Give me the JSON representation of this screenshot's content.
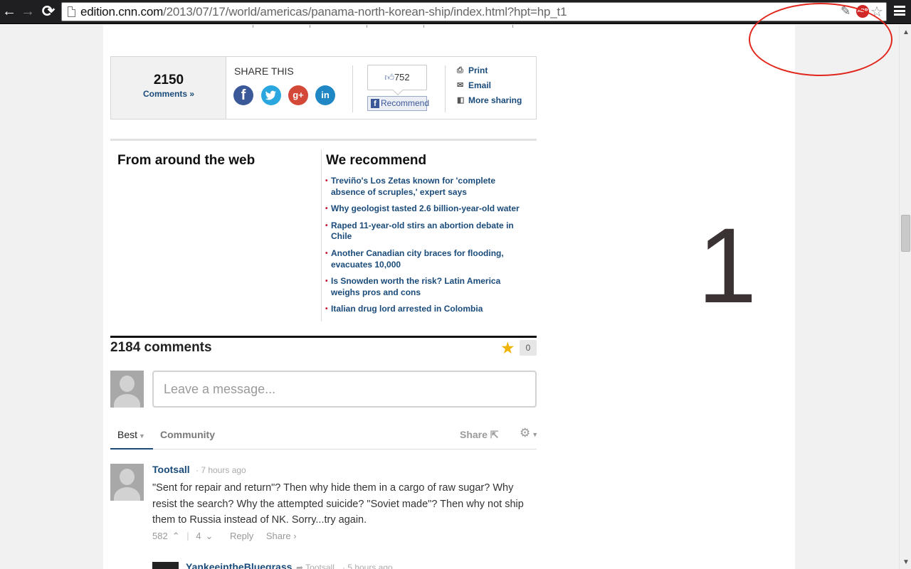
{
  "browser": {
    "url_domain": "edition.cnn.com",
    "url_path": "/2013/07/17/world/americas/panama-north-korean-ship/index.html?hpt=hp_t1",
    "back_glyph": "←",
    "forward_glyph": "→",
    "reload_glyph": "⟳",
    "abp_label": "ABP",
    "extension_icons": [
      "pen-icon",
      "adblock-icon",
      "star-icon"
    ]
  },
  "annotation": {
    "number": "1",
    "ellipse_color": "#e1261c"
  },
  "share_bar": {
    "comment_count": "2150",
    "comments_link": "Comments »",
    "title": "SHARE THIS",
    "social": [
      {
        "name": "facebook-icon",
        "glyph": "f"
      },
      {
        "name": "twitter-icon",
        "glyph": "t"
      },
      {
        "name": "googleplus-icon",
        "glyph": "g+"
      },
      {
        "name": "linkedin-icon",
        "glyph": "in"
      }
    ],
    "like_count": "752",
    "recommend_label": "Recommend",
    "links": {
      "print": "Print",
      "email": "Email",
      "more": "More sharing"
    }
  },
  "recommendations": {
    "left_title": "From around the web",
    "right_title": "We recommend",
    "items": [
      "Treviño's Los Zetas known for 'complete absence of scruples,' expert says",
      "Why geologist tasted 2.6 billion-year-old water",
      "Raped 11-year-old stirs an abortion debate in Chile",
      "Another Canadian city braces for flooding, evacuates 10,000",
      "Is Snowden worth the risk? Latin America weighs pros and cons",
      "Italian drug lord arrested in Colombia"
    ]
  },
  "comments": {
    "count_label": "2184 comments",
    "star_count": "0",
    "placeholder": "Leave a message...",
    "tabs": {
      "best": "Best",
      "community": "Community",
      "share": "Share"
    },
    "first": {
      "author": "Tootsall",
      "time": "· 7 hours ago",
      "text": "\"Sent for repair and return\"? Then why hide them in a cargo of raw sugar? Why resist the search? Why the attempted suicide? \"Soviet made\"? Then why not ship them to Russia instead of NK. Sorry...try again.",
      "upvotes": "582",
      "downvotes": "4",
      "reply": "Reply",
      "share": "Share ›"
    },
    "reply_preview": {
      "author": "YankeeintheBluegrass",
      "in_reply_to": "Tootsall",
      "time": "· 5 hours ago"
    }
  },
  "colors": {
    "link_blue": "#1a4b7a",
    "bullet_red": "#c8102e",
    "star_gold": "#f0b400"
  }
}
